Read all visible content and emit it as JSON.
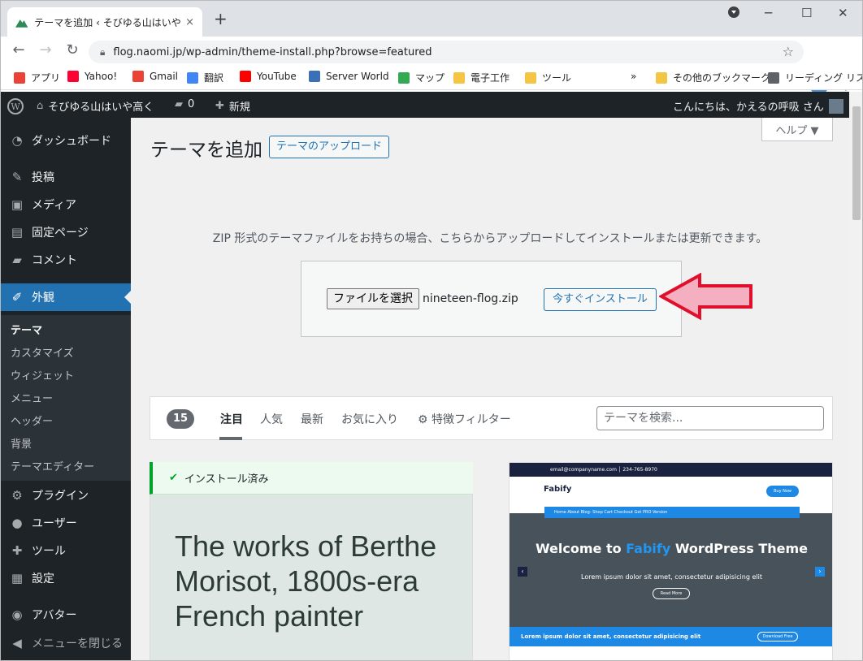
{
  "browser": {
    "tab_title": "テーマを追加 ‹ そびゆる山はいや高く — W",
    "tab_close": "×",
    "new_tab": "+",
    "url": "flog.naomi.jp/wp-admin/theme-install.php?browse=featured",
    "bookmarks": [
      {
        "label": "アプリ",
        "color": "#ea4335"
      },
      {
        "label": "Yahoo!",
        "color": "#ff0033"
      },
      {
        "label": "Gmail",
        "color": "#ea4335"
      },
      {
        "label": "翻訳",
        "color": "#4285f4"
      },
      {
        "label": "YouTube",
        "color": "#ff0000"
      },
      {
        "label": "Server World",
        "color": "#3b6fb6"
      },
      {
        "label": "マップ",
        "color": "#34a853"
      },
      {
        "label": "電子工作",
        "color": "#f4c542"
      },
      {
        "label": "ツール",
        "color": "#f4c542"
      },
      {
        "label": "»",
        "color": ""
      },
      {
        "label": "その他のブックマーク",
        "color": "#f4c542"
      },
      {
        "label": "リーディング リスト",
        "color": "#5f6368"
      }
    ]
  },
  "adminbar": {
    "site_name": "そびゆる山はいや高く",
    "comments_count": "0",
    "new_label": "新規",
    "greeting": "こんにちは、かえるの呼吸 さん"
  },
  "sidebar": {
    "items": [
      {
        "label": "ダッシュボード",
        "icon": "dashboard-icon",
        "glyph": "◔"
      },
      {
        "label": "投稿",
        "icon": "pin-icon",
        "glyph": "✎"
      },
      {
        "label": "メディア",
        "icon": "media-icon",
        "glyph": "▣"
      },
      {
        "label": "固定ページ",
        "icon": "page-icon",
        "glyph": "▤"
      },
      {
        "label": "コメント",
        "icon": "comment-icon",
        "glyph": "▰"
      },
      {
        "label": "外観",
        "icon": "appearance-icon",
        "glyph": "✐"
      },
      {
        "label": "プラグイン",
        "icon": "plugin-icon",
        "glyph": "⚙"
      },
      {
        "label": "ユーザー",
        "icon": "user-icon",
        "glyph": "●"
      },
      {
        "label": "ツール",
        "icon": "tool-icon",
        "glyph": "✚"
      },
      {
        "label": "設定",
        "icon": "settings-icon",
        "glyph": "▦"
      },
      {
        "label": "アバター",
        "icon": "avatar-icon",
        "glyph": "◉"
      },
      {
        "label": "メニューを閉じる",
        "icon": "collapse-icon",
        "glyph": "◀"
      }
    ],
    "submenu": [
      "テーマ",
      "カスタマイズ",
      "ウィジェット",
      "メニュー",
      "ヘッダー",
      "背景",
      "テーマエディター"
    ]
  },
  "page": {
    "title": "テーマを追加",
    "upload_button": "テーマのアップロード",
    "help": "ヘルプ ▼",
    "upload_desc": "ZIP 形式のテーマファイルをお持ちの場合、こちらからアップロードしてインストールまたは更新できます。",
    "choose_file": "ファイルを選択",
    "file_name": "nineteen-flog.zip",
    "install_now": "今すぐインストール"
  },
  "filter": {
    "count": "15",
    "tabs": [
      "注目",
      "人気",
      "最新",
      "お気に入り",
      "特徴フィルター"
    ],
    "search_placeholder": "テーマを検索..."
  },
  "themes": {
    "installed_label": "インストール済み",
    "card1_title": "The works of Berthe Morisot, 1800s-era French painter",
    "card2": {
      "topbar": "email@companyname.com  │  234-765-8970",
      "logo": "Fabify",
      "buy": "Buy Now",
      "nav": "Home   About   Blog-   Shop   Cart   Checkout   Get PRO Version",
      "hero_pre": "Welcome to ",
      "hero_hl": "Fabify",
      "hero_post": " WordPress Theme",
      "hero_sub": "Lorem ipsum dolor sit amet, consectetur adipisicing elit",
      "read_more": "Read More",
      "band": "Lorem ipsum dolor sit amet, consectetur adipisicing elit",
      "download": "Download Free"
    }
  },
  "colors": {
    "admin_dark": "#1d2327",
    "accent": "#2271b1",
    "arrow_fill": "#f4b0c0",
    "arrow_stroke": "#e0102c"
  }
}
